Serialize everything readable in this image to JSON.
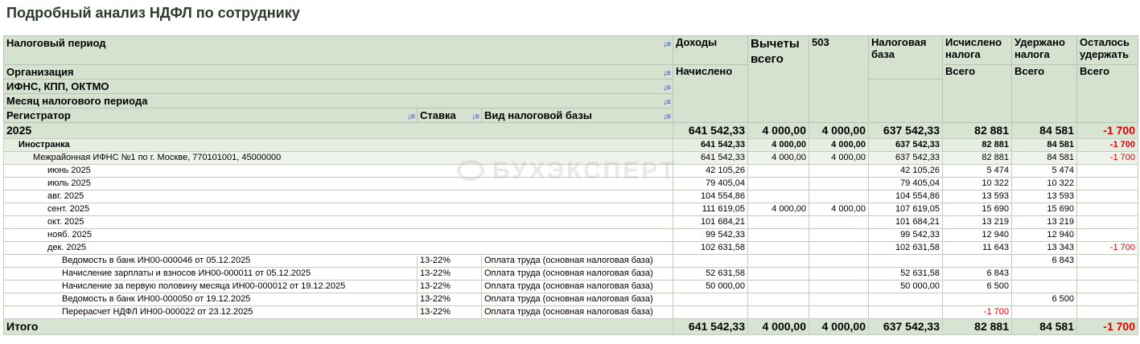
{
  "title": "Подробный анализ НДФЛ по сотруднику",
  "watermark": "БУХЭКСПЕРТ",
  "header": {
    "period": "Налоговый период",
    "org": "Организация",
    "ifns": "ИФНС, КПП, ОКТМО",
    "month": "Месяц налогового периода",
    "registrar": "Регистратор",
    "rate": "Ставка",
    "base_type": "Вид налоговой базы",
    "income": "Доходы",
    "accrued": "Начислено",
    "deductions_l1": "Вычеты",
    "deductions_l2": "всего",
    "code503": "503",
    "base_l1": "Налоговая",
    "base_l2": "база",
    "calc_l1": "Исчислено",
    "calc_l2": "налога",
    "withheld_l1": "Удержано",
    "withheld_l2": "налога",
    "remain_l1": "Осталось",
    "remain_l2": "удержать",
    "total_word": "Всего",
    "sort_icon": "sort-icon"
  },
  "colors": {
    "header_bg": "#d6e2d0",
    "group_bg": "#d8e4d2",
    "negative": "#e00000"
  },
  "year_row": {
    "label": "2025",
    "income": "641 542,33",
    "ded": "4 000,00",
    "c503": "4 000,00",
    "base": "637 542,33",
    "calc": "82 881",
    "withheld": "84 581",
    "remain": "-1 700"
  },
  "org_row": {
    "label": "Иностранка",
    "income": "641 542,33",
    "ded": "4 000,00",
    "c503": "4 000,00",
    "base": "637 542,33",
    "calc": "82 881",
    "withheld": "84 581",
    "remain": "-1 700"
  },
  "ifns_row": {
    "label": "Межрайонная ИФНС №1 по г. Москве, 770101001, 45000000",
    "income": "641 542,33",
    "ded": "4 000,00",
    "c503": "4 000,00",
    "base": "637 542,33",
    "calc": "82 881",
    "withheld": "84 581",
    "remain": "-1 700"
  },
  "months": [
    {
      "label": "июнь 2025",
      "income": "42 105,26",
      "ded": "",
      "c503": "",
      "base": "42 105,26",
      "calc": "5 474",
      "withheld": "5 474",
      "remain": ""
    },
    {
      "label": "июль 2025",
      "income": "79 405,04",
      "ded": "",
      "c503": "",
      "base": "79 405,04",
      "calc": "10 322",
      "withheld": "10 322",
      "remain": ""
    },
    {
      "label": "авг. 2025",
      "income": "104 554,86",
      "ded": "",
      "c503": "",
      "base": "104 554,86",
      "calc": "13 593",
      "withheld": "13 593",
      "remain": ""
    },
    {
      "label": "сент. 2025",
      "income": "111 619,05",
      "ded": "4 000,00",
      "c503": "4 000,00",
      "base": "107 619,05",
      "calc": "15 690",
      "withheld": "15 690",
      "remain": ""
    },
    {
      "label": "окт. 2025",
      "income": "101 684,21",
      "ded": "",
      "c503": "",
      "base": "101 684,21",
      "calc": "13 219",
      "withheld": "13 219",
      "remain": ""
    },
    {
      "label": "нояб. 2025",
      "income": "99 542,33",
      "ded": "",
      "c503": "",
      "base": "99 542,33",
      "calc": "12 940",
      "withheld": "12 940",
      "remain": ""
    },
    {
      "label": "дек. 2025",
      "income": "102 631,58",
      "ded": "",
      "c503": "",
      "base": "102 631,58",
      "calc": "11 643",
      "withheld": "13 343",
      "remain": "-1 700"
    }
  ],
  "docs": [
    {
      "label": "Ведомость в банк ИН00-000046 от 05.12.2025",
      "rate": "13-22%",
      "type": "Оплата труда (основная налоговая база)",
      "income": "",
      "ded": "",
      "c503": "",
      "base": "",
      "calc": "",
      "withheld": "6 843",
      "remain": ""
    },
    {
      "label": "Начисление зарплаты и взносов ИН00-000011 от 05.12.2025",
      "rate": "13-22%",
      "type": "Оплата труда (основная налоговая база)",
      "income": "52 631,58",
      "ded": "",
      "c503": "",
      "base": "52 631,58",
      "calc": "6 843",
      "withheld": "",
      "remain": ""
    },
    {
      "label": "Начисление за первую половину месяца ИН00-000012 от 19.12.2025",
      "rate": "13-22%",
      "type": "Оплата труда (основная налоговая база)",
      "income": "50 000,00",
      "ded": "",
      "c503": "",
      "base": "50 000,00",
      "calc": "6 500",
      "withheld": "",
      "remain": ""
    },
    {
      "label": "Ведомость в банк ИН00-000050 от 19.12.2025",
      "rate": "13-22%",
      "type": "Оплата труда (основная налоговая база)",
      "income": "",
      "ded": "",
      "c503": "",
      "base": "",
      "calc": "",
      "withheld": "6 500",
      "remain": ""
    },
    {
      "label": "Перерасчет НДФЛ ИН00-000022 от 23.12.2025",
      "rate": "13-22%",
      "type": "Оплата труда (основная налоговая база)",
      "income": "",
      "ded": "",
      "c503": "",
      "base": "",
      "calc": "-1 700",
      "withheld": "",
      "remain": ""
    }
  ],
  "total_row": {
    "label": "Итого",
    "income": "641 542,33",
    "ded": "4 000,00",
    "c503": "4 000,00",
    "base": "637 542,33",
    "calc": "82 881",
    "withheld": "84 581",
    "remain": "-1 700"
  }
}
